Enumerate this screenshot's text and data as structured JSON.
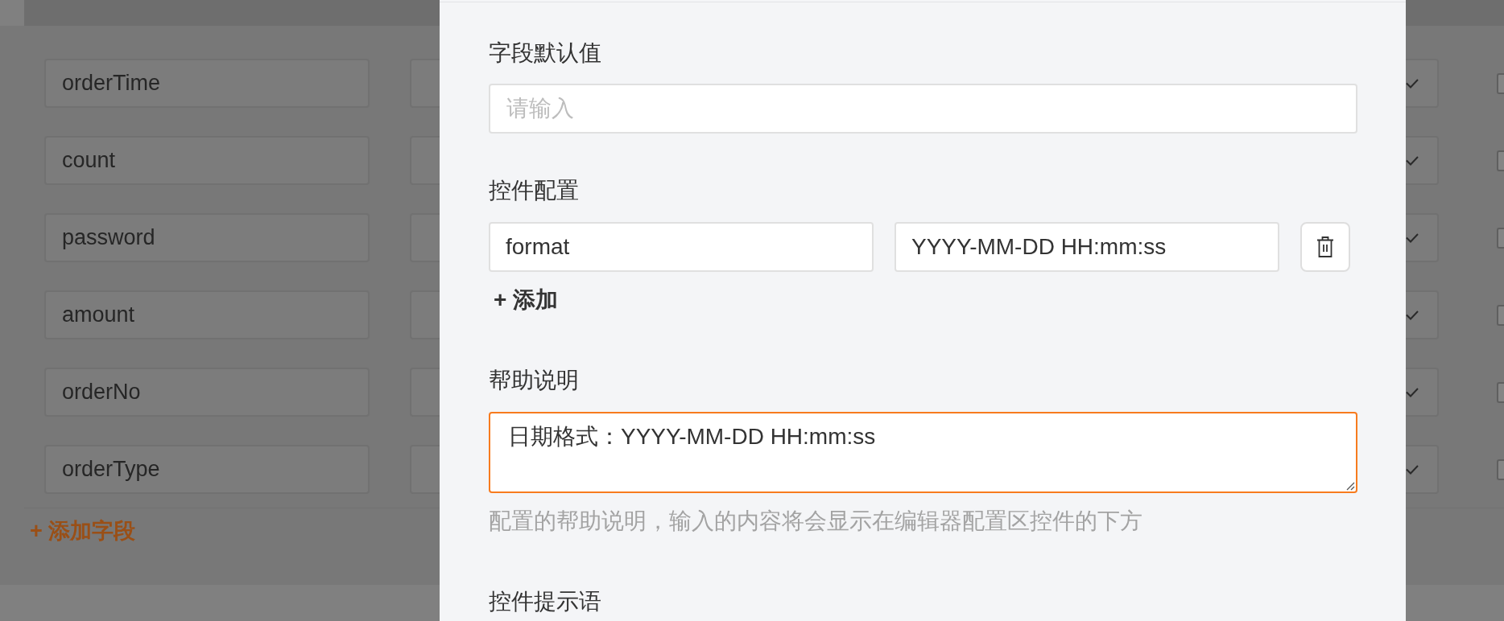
{
  "background_form": {
    "rows": [
      {
        "field_name": "orderTime",
        "checked": false
      },
      {
        "field_name": "count",
        "checked": false
      },
      {
        "field_name": "password",
        "checked": false
      },
      {
        "field_name": "amount",
        "checked": false
      },
      {
        "field_name": "orderNo",
        "checked": false
      },
      {
        "field_name": "orderType",
        "checked": false
      }
    ],
    "add_field_button": "+ 添加字段"
  },
  "dialog": {
    "default_value": {
      "label": "字段默认值",
      "placeholder": "请输入"
    },
    "widget_config": {
      "label": "控件配置",
      "entries": [
        {
          "key": "format",
          "value": "YYYY-MM-DD HH:mm:ss"
        }
      ],
      "add_button": "+ 添加"
    },
    "help_text": {
      "label": "帮助说明",
      "value": "日期格式：YYYY-MM-DD HH:mm:ss",
      "focused": true,
      "hint": "配置的帮助说明，输入的内容将会显示在编辑器配置区控件的下方"
    },
    "widget_placeholder": {
      "label": "控件提示语"
    }
  }
}
